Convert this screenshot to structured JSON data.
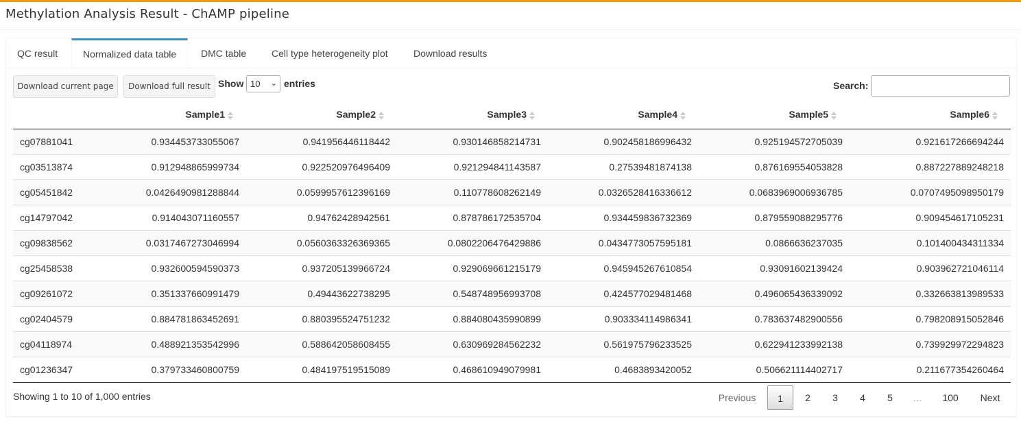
{
  "app": {
    "title": "Methylation Analysis Result - ChAMP pipeline",
    "accent_color": "#f39c12",
    "tab_accent_color": "#3c8dbc"
  },
  "tabs": [
    {
      "label": "QC result",
      "active": false
    },
    {
      "label": "Normalized data table",
      "active": true
    },
    {
      "label": "DMC table",
      "active": false
    },
    {
      "label": "Cell type heterogeneity plot",
      "active": false
    },
    {
      "label": "Download results",
      "active": false
    }
  ],
  "toolbar": {
    "download_current_label": "Download current page",
    "download_full_label": "Download full result",
    "show_label": "Show",
    "entries_value": "10",
    "entries_label": "entries",
    "search_label": "Search:",
    "search_value": ""
  },
  "table": {
    "columns": [
      "",
      "Sample1",
      "Sample2",
      "Sample3",
      "Sample4",
      "Sample5",
      "Sample6"
    ],
    "rows": [
      [
        "cg07881041",
        "0.934453733055067",
        "0.941956446118442",
        "0.930146858214731",
        "0.902458186996432",
        "0.925194572705039",
        "0.921617266694244"
      ],
      [
        "cg03513874",
        "0.912948865999734",
        "0.922520976496409",
        "0.921294841143587",
        "0.27539481874138",
        "0.876169554053828",
        "0.887227889248218"
      ],
      [
        "cg05451842",
        "0.0426490981288844",
        "0.0599957612396169",
        "0.110778608262149",
        "0.0326528416336612",
        "0.0683969006936785",
        "0.0707495098950179"
      ],
      [
        "cg14797042",
        "0.914043071160557",
        "0.94762428942561",
        "0.878786172535704",
        "0.934459836732369",
        "0.879559088295776",
        "0.909454617105231"
      ],
      [
        "cg09838562",
        "0.0317467273046994",
        "0.0560363326369365",
        "0.0802206476429886",
        "0.0434773057595181",
        "0.0866636237035",
        "0.101400434311334"
      ],
      [
        "cg25458538",
        "0.932600594590373",
        "0.937205139966724",
        "0.929069661215179",
        "0.945945267610854",
        "0.93091602139424",
        "0.903962721046114"
      ],
      [
        "cg09261072",
        "0.351337660991479",
        "0.49443622738295",
        "0.548748956993708",
        "0.424577029481468",
        "0.496065436339092",
        "0.332663813989533"
      ],
      [
        "cg02404579",
        "0.884781863452691",
        "0.880395524751232",
        "0.884080435990899",
        "0.903334114986341",
        "0.783637482900556",
        "0.798208915052846"
      ],
      [
        "cg04118974",
        "0.488921353542996",
        "0.588642058608455",
        "0.630969284562232",
        "0.561975796233525",
        "0.622941233992138",
        "0.739929972294823"
      ],
      [
        "cg01236347",
        "0.379733460800759",
        "0.484197519515089",
        "0.468610949079981",
        "0.4683893420052",
        "0.506621114402717",
        "0.211677354260464"
      ]
    ]
  },
  "footer": {
    "info": "Showing 1 to 10 of 1,000 entries",
    "pagination": [
      "Previous",
      "1",
      "2",
      "3",
      "4",
      "5",
      "…",
      "100",
      "Next"
    ],
    "current_page": "1"
  }
}
